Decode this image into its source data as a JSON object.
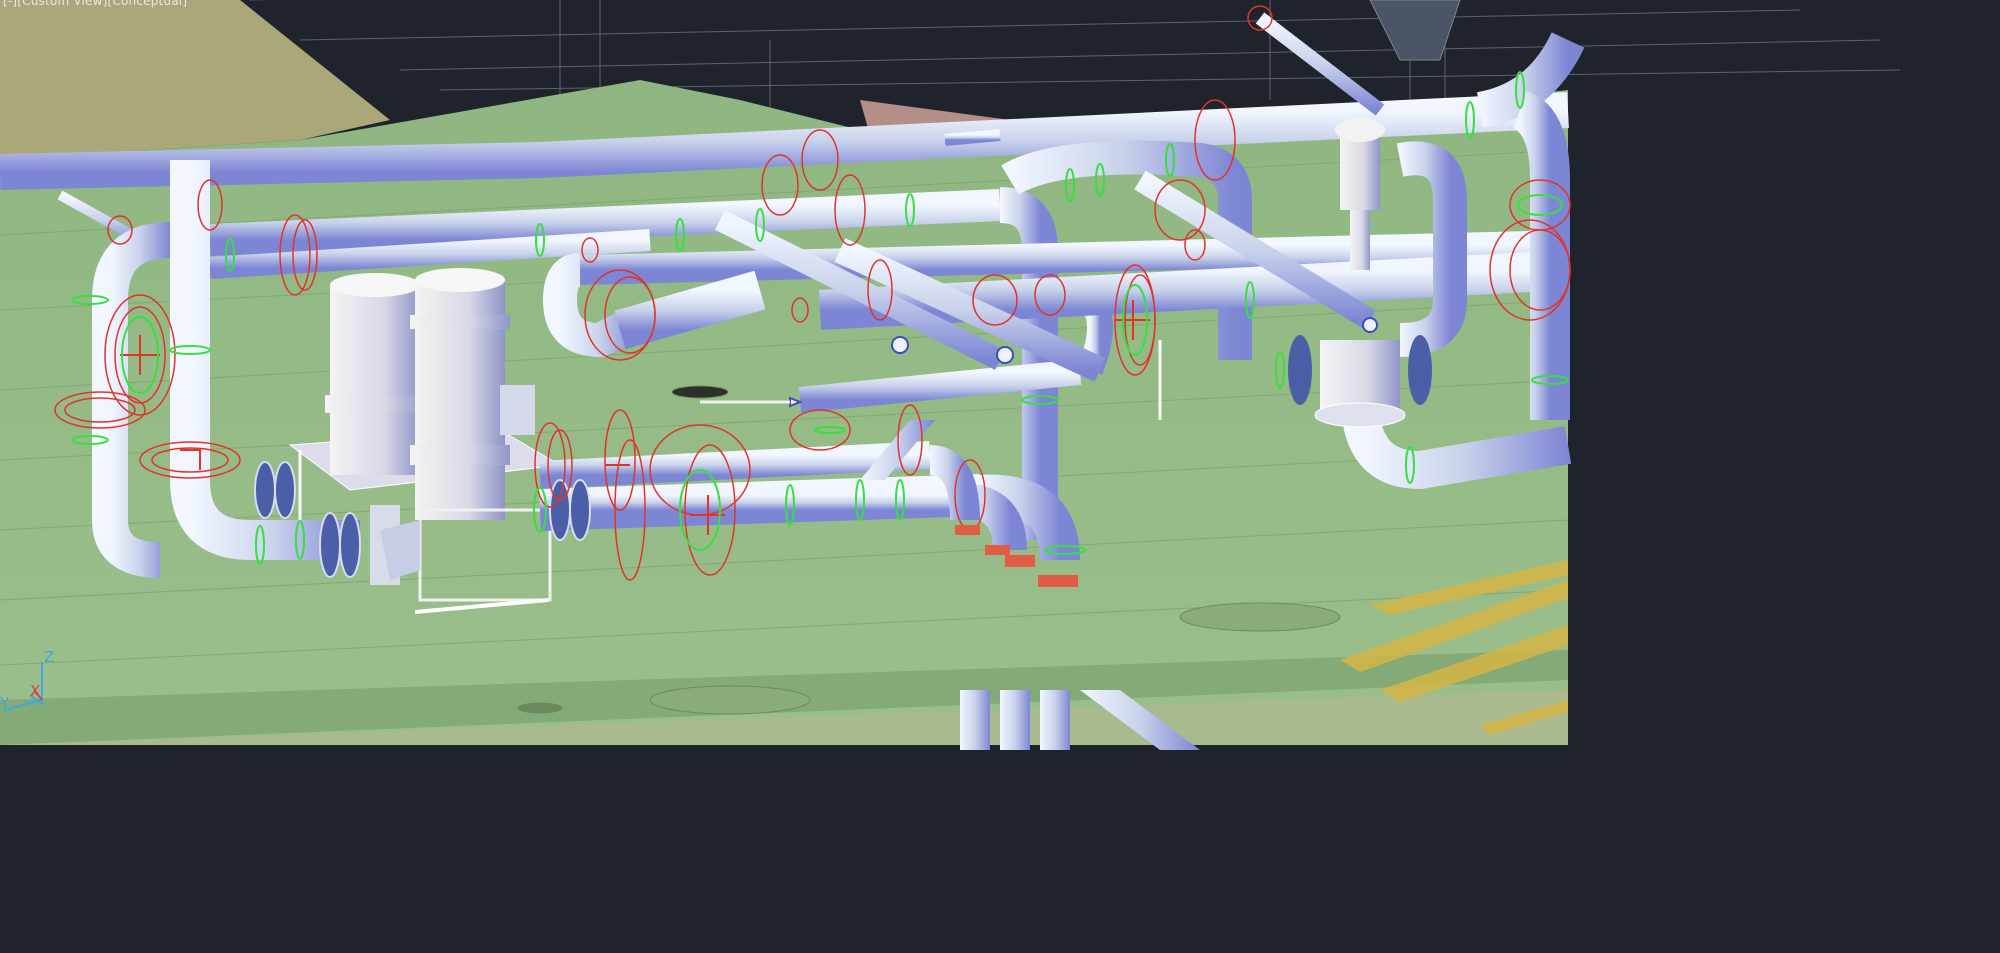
{
  "viewport": {
    "label": "[-][Custom View][Conceptual]",
    "visual_style": "Conceptual"
  },
  "ucs": {
    "z_label": "Z",
    "y_label": "Y",
    "x_label": "X"
  },
  "colors": {
    "background": "#1f242c",
    "deck": "#93b985",
    "pipe": "#cfd6e6",
    "flange_wire": "#e0342b",
    "weld_ring": "#35e03f",
    "upper_plate": "#aaa878"
  }
}
